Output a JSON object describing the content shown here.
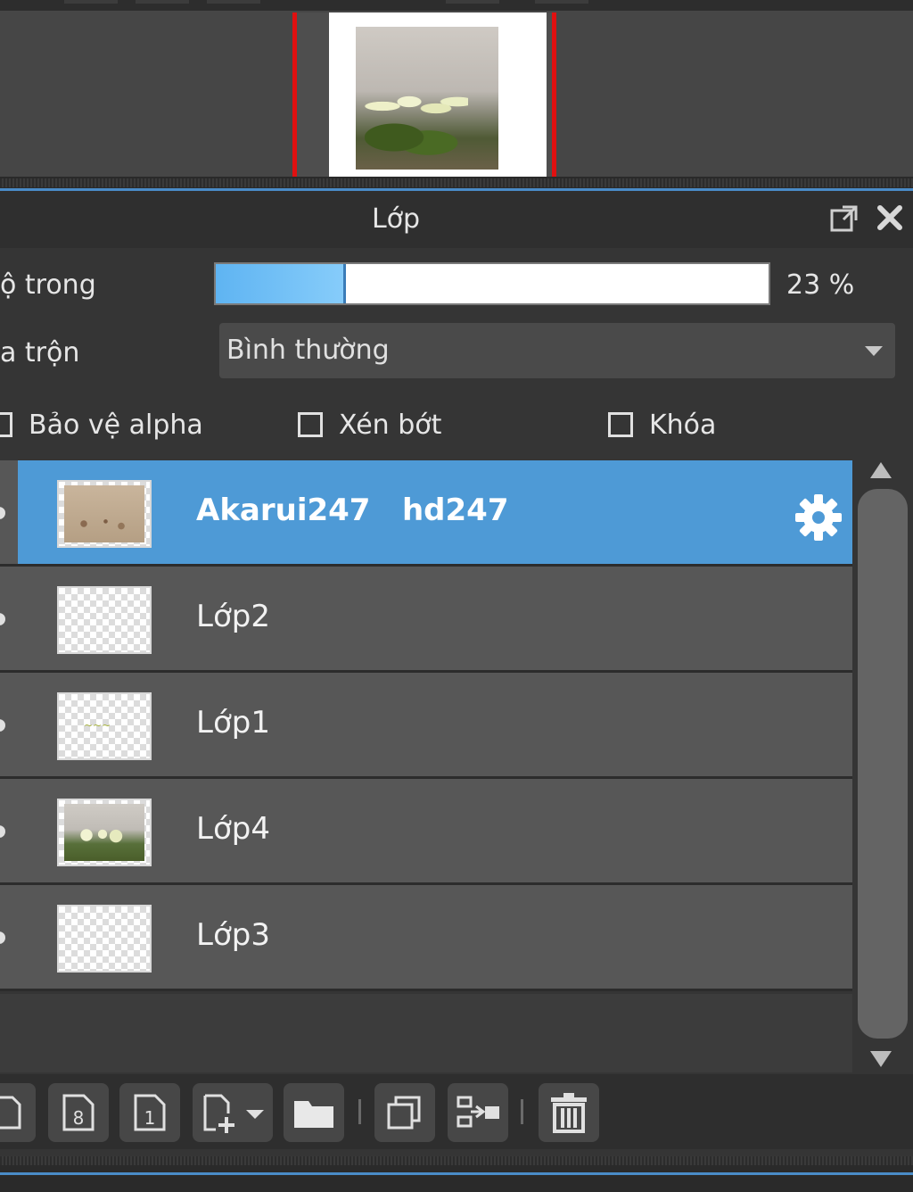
{
  "panel": {
    "title": "Lớp",
    "opacity_label": "ộ trong",
    "opacity_value": 0.23,
    "opacity_text": "23 %",
    "blend_label": "a trộn",
    "blend_mode": "Bình thường",
    "checkboxes": [
      {
        "label": "Bảo vệ alpha",
        "checked": false
      },
      {
        "label": "Xén bớt",
        "checked": false
      },
      {
        "label": "Khóa",
        "checked": false
      }
    ]
  },
  "layers": [
    {
      "name": "Akarui247   hd247",
      "selected": true,
      "thumb": "beige-photo"
    },
    {
      "name": "Lớp2",
      "selected": false,
      "thumb": "transparent"
    },
    {
      "name": "Lớp1",
      "selected": false,
      "thumb": "text-mark"
    },
    {
      "name": "Lớp4",
      "selected": false,
      "thumb": "flower-photo"
    },
    {
      "name": "Lớp3",
      "selected": false,
      "thumb": "transparent"
    }
  ],
  "toolbar": {
    "buttons": [
      "new-layer-icon",
      "new-8bit-layer-icon",
      "new-1bit-layer-icon",
      "add-layer-dropdown-icon",
      "folder-icon",
      "duplicate-icon",
      "merge-down-icon",
      "trash-icon"
    ]
  },
  "colors": {
    "selected_row": "#4e9ad6",
    "slider_fill": "#6dbcf4",
    "navigator_frame": "#e01010"
  }
}
